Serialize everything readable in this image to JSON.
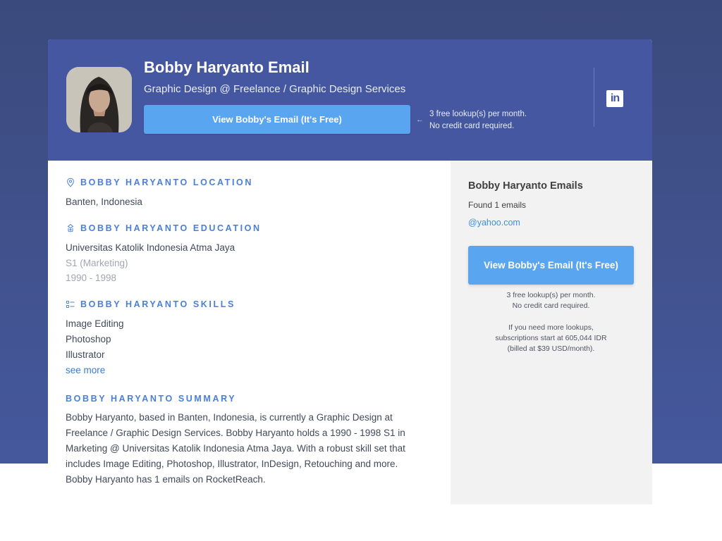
{
  "header": {
    "name": "Bobby Haryanto Email",
    "headline": "Graphic Design @ Freelance / Graphic Design Services",
    "cta_label": "View Bobby's Email (It's Free)",
    "note_line1": "3 free lookup(s) per month.",
    "note_line2": "No credit card required.",
    "arrow": "←",
    "linkedin_label": "in"
  },
  "location": {
    "title": "BOBBY HARYANTO LOCATION",
    "value": "Banten, Indonesia"
  },
  "education": {
    "title": "BOBBY HARYANTO EDUCATION",
    "school": "Universitas Katolik Indonesia Atma Jaya",
    "degree": "S1 (Marketing)",
    "years": "1990 - 1998"
  },
  "skills": {
    "title": "BOBBY HARYANTO SKILLS",
    "items": [
      "Image Editing",
      "Photoshop",
      "Illustrator"
    ],
    "see_more": "see more"
  },
  "summary": {
    "title": "BOBBY HARYANTO SUMMARY",
    "lines": [
      "Bobby Haryanto, based in Banten, Indonesia, is currently a Graphic Design at",
      "Freelance / Graphic Design Services. Bobby Haryanto holds a 1990 - 1998 S1 in",
      "Marketing @ Universitas Katolik Indonesia Atma Jaya. With a robust skill set that",
      "includes Image Editing, Photoshop, Illustrator, InDesign, Retouching and more.",
      "Bobby Haryanto has 1 emails on RocketReach."
    ]
  },
  "sidebar": {
    "title": "Bobby Haryanto Emails",
    "found": "Found 1 emails",
    "domain": "@yahoo.com",
    "cta_label": "View Bobby's Email (It's Free)",
    "note_line1": "3 free lookup(s) per month.",
    "note_line2": "No credit card required.",
    "sub_line1": "If you need more lookups,",
    "sub_line2": "subscriptions start at 605,044 IDR",
    "sub_line3": "(billed at $39 USD/month)."
  },
  "colors": {
    "header_bg": "#4557a0",
    "accent_blue": "#5aa5f0",
    "section_title": "#4a7fd8"
  }
}
